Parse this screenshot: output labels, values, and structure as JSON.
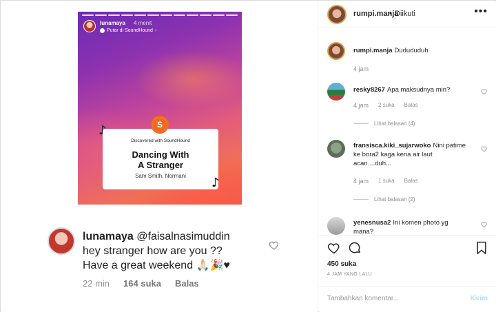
{
  "story": {
    "username": "lunamaya",
    "time": "4 menit",
    "subtitle": "Putar di SoundHound",
    "card": {
      "discovered": "Discovered with SoundHound",
      "title_line1": "Dancing With",
      "title_line2": "A Stranger",
      "artist": "Sam Smith, Normani"
    }
  },
  "embedded_comment": {
    "username": "lunamaya",
    "mention": "@faisalnasimuddin",
    "line1": "hey stranger how are you ??",
    "line2": "Have a great weekend 🙏🏻🎉♥",
    "time": "22 min",
    "likes": "164 suka",
    "reply": "Balas"
  },
  "header": {
    "username": "rumpi.manja",
    "separator": "•",
    "follow_status": "Diikuti",
    "more": "•••"
  },
  "comments": [
    {
      "username": "rumpi.manja",
      "text": "Dudududuh",
      "time": "4 jam"
    },
    {
      "username": "resky8267",
      "text": "Apa maksudnya min?",
      "time": "4 jam",
      "likes": "2 suka",
      "reply": "Balas",
      "view_replies": "Lihat balasan (4)"
    },
    {
      "username": "fransisca.kiki_sujarwoko",
      "text": "Nini patime ke bora2 kaga kena air laut acan....duh...",
      "time": "4 jam",
      "likes": "1 suka",
      "reply": "Balas",
      "view_replies": "Lihat balasan (2)"
    },
    {
      "username": "yenesnusa2",
      "text": "Ini komen photo yg mana?"
    }
  ],
  "actions": {
    "likes": "450 suka",
    "posted": "4 JAM YANG LALU"
  },
  "add_comment": {
    "placeholder": "Tambahkan komentar...",
    "send": "Kirim"
  }
}
